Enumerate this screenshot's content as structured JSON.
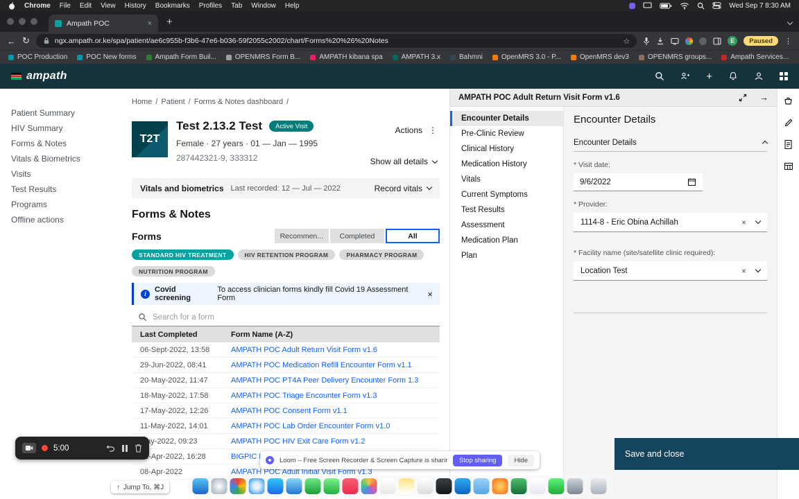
{
  "colors": {
    "header_bg": "#14333d",
    "accent_teal": "#007d79",
    "link_blue": "#0f62fe",
    "notice_bg": "#edf5ff",
    "save_bg": "#15455c",
    "loom_purple": "#625df5"
  },
  "glyphs": {
    "back": "←",
    "reload": "↻",
    "kebab": "⋮",
    "star": "☆",
    "plus": "+",
    "close": "×",
    "arrow_right": "→",
    "slash": "/",
    "info": "i",
    "up_arrow": "↑"
  },
  "menubar": {
    "items": [
      "Chrome",
      "File",
      "Edit",
      "View",
      "History",
      "Bookmarks",
      "Profiles",
      "Tab",
      "Window",
      "Help"
    ],
    "clock": "Wed Sep 7 8:30 AM"
  },
  "browser": {
    "tab_title": "Ampath POC",
    "url": "ngx.ampath.or.ke/spa/patient/ae6c955b-f3b6-47e6-b036-59f2055c2002/chart/Forms%20%26%20Notes",
    "profile_initial": "E",
    "paused_badge": "Paused",
    "bookmarks": [
      {
        "label": "POC Production",
        "color": "#0097a7"
      },
      {
        "label": "POC New forms",
        "color": "#0097a7"
      },
      {
        "label": "Ampath Form Buil...",
        "color": "#2e7d32"
      },
      {
        "label": "OPENMRS Form B...",
        "color": "#9e9e9e"
      },
      {
        "label": "AMPATH kibana spa",
        "color": "#e91e63"
      },
      {
        "label": "AMPATH 3.x",
        "color": "#00695c"
      },
      {
        "label": "Bahmni",
        "color": "#37474f"
      },
      {
        "label": "OpenMRS 3.0 - P...",
        "color": "#f57c00"
      },
      {
        "label": "OpenMRS dev3",
        "color": "#f57c00"
      },
      {
        "label": "OPENMRS groups...",
        "color": "#8d6e63"
      },
      {
        "label": "Ampath Services...",
        "color": "#c62828"
      }
    ]
  },
  "app_header": {
    "logo": "ampath"
  },
  "sidebar": {
    "items": [
      "Patient Summary",
      "HIV Summary",
      "Forms & Notes",
      "Vitals & Biometrics",
      "Visits",
      "Test Results",
      "Programs",
      "Offline actions"
    ]
  },
  "breadcrumb": [
    "Home",
    "Patient",
    "Forms & Notes dashboard"
  ],
  "patient": {
    "avatar": "T2T",
    "name": "Test 2.13.2 Test",
    "visit_tag": "Active Visit",
    "demographics": "Female · 27 years · 01 — Jan — 1995",
    "ids": "287442321-9, 333312",
    "actions": "Actions",
    "show_details": "Show all details"
  },
  "vitals_bar": {
    "title": "Vitals and biometrics",
    "last_recorded": "Last recorded: 12 — Jul — 2022",
    "record_vitals": "Record vitals"
  },
  "forms_section": {
    "page_title": "Forms & Notes",
    "widget_title": "Forms",
    "tabs": [
      "Recommen...",
      "Completed",
      "All"
    ],
    "tags": [
      "STANDARD HIV TREATMENT",
      "HIV RETENTION PROGRAM",
      "PHARMACY PROGRAM",
      "NUTRITION PROGRAM"
    ],
    "notice": {
      "title": "Covid screening",
      "message": "To access clinician forms kindly fill Covid 19 Assessment Form"
    },
    "search_placeholder": "Search for a form",
    "table": {
      "col_date": "Last Completed",
      "col_name": "Form Name (A-Z)",
      "rows": [
        {
          "date": "06-Sept-2022, 13:58",
          "name": "AMPATH POC Adult Return Visit Form v1.6"
        },
        {
          "date": "29-Jun-2022, 08:41",
          "name": "AMPATH POC Medication Refill Encounter Form v1.1"
        },
        {
          "date": "20-May-2022, 11:47",
          "name": "AMPATH POC PT4A Peer Delivery Encounter Form 1.3"
        },
        {
          "date": "18-May-2022, 17:58",
          "name": "AMPATH POC Triage Encounter Form v1.3"
        },
        {
          "date": "17-May-2022, 12:26",
          "name": "AMPATH POC Consent Form v1.1"
        },
        {
          "date": "11-May-2022, 14:01",
          "name": "AMPATH POC Lab Order Encounter Form v1.0"
        },
        {
          "date": "May-2022, 09:23",
          "name": "AMPATH POC HIV Exit Care Form v1.2"
        },
        {
          "date": "22-Apr-2022, 16:28",
          "name": "BIGPIC F"
        },
        {
          "date": "08-Apr-2022",
          "name": "AMPATH POC Adult Initial Visit Form v1.3"
        }
      ]
    }
  },
  "workspace": {
    "title": "AMPATH POC Adult Return Visit Form v1.6",
    "nav": [
      "Encounter Details",
      "Pre-Clinic Review",
      "Clinical History",
      "Medication History",
      "Vitals",
      "Current Symptoms",
      "Test Results",
      "Assessment",
      "Medication Plan",
      "Plan"
    ],
    "section_title": "Encounter Details",
    "accordion_title": "Encounter Details",
    "fields": {
      "visit_date_label": "* Visit date:",
      "visit_date_value": "9/6/2022",
      "provider_label": "* Provider:",
      "provider_value": "1114-8 - Eric Obina Achillah",
      "facility_label": "* Facility name (site/satellite clinic required):",
      "facility_value": "Location Test"
    },
    "save_button": "Save and close"
  },
  "recorder": {
    "time": "5:00"
  },
  "loom_banner": {
    "message": "Loom – Free Screen Recorder & Screen Capture is sharing your screen.",
    "stop": "Stop sharing",
    "hide": "Hide"
  },
  "jump_to": "Jump To, ⌘J",
  "dock": {
    "apps": [
      {
        "name": "finder",
        "bg": "linear-gradient(180deg,#59c3f3,#1667c9)"
      },
      {
        "name": "launchpad",
        "bg": "radial-gradient(circle,#ffffff,#9aa7b5)"
      },
      {
        "name": "chrome",
        "bg": "conic-gradient(#ea4335,#fbbc05,#34a853,#4285f4,#ea4335)"
      },
      {
        "name": "safari",
        "bg": "radial-gradient(circle,#e8f4fd 25%,#1b88e5)"
      },
      {
        "name": "app-store",
        "bg": "linear-gradient(180deg,#2fc8fa,#1a6ae8)"
      },
      {
        "name": "mail",
        "bg": "linear-gradient(180deg,#8bd5f7,#1f78d1)"
      },
      {
        "name": "facetime",
        "bg": "linear-gradient(180deg,#6ee787,#18a034)"
      },
      {
        "name": "messages",
        "bg": "linear-gradient(180deg,#7ef08c,#1fb141)"
      },
      {
        "name": "music",
        "bg": "linear-gradient(180deg,#fb5c74,#e62e4d)"
      },
      {
        "name": "photos",
        "bg": "conic-gradient(#f6c344,#ec6b56,#b460d6,#4a90e2,#50c878,#f6c344)"
      },
      {
        "name": "calendar",
        "bg": "linear-gradient(180deg,#ffffff,#e8e8e8)"
      },
      {
        "name": "notes",
        "bg": "linear-gradient(180deg,#ffe484,#ffffff)"
      },
      {
        "name": "reminders",
        "bg": "linear-gradient(180deg,#ffffff,#dcdcdc)"
      },
      {
        "name": "terminal",
        "bg": "linear-gradient(180deg,#3a3f44,#14171a)"
      },
      {
        "name": "vscode",
        "bg": "linear-gradient(180deg,#31a8f0,#0b67c2)"
      },
      {
        "name": "folder",
        "bg": "linear-gradient(180deg,#9ed0f5,#53a6e8)"
      },
      {
        "name": "firefox",
        "bg": "radial-gradient(circle,#ffd567,#ff6611)"
      },
      {
        "name": "excel",
        "bg": "linear-gradient(180deg,#4dbf6c,#156f39)"
      },
      {
        "name": "slack",
        "bg": "linear-gradient(180deg,#ffffff,#e9e4ef)"
      },
      {
        "name": "whatsapp",
        "bg": "linear-gradient(180deg,#5ef27c,#1fae38)"
      },
      {
        "name": "settings",
        "bg": "linear-gradient(180deg,#cfd4da,#7d8692)"
      },
      {
        "name": "trash",
        "bg": "linear-gradient(180deg,#e8ebee,#aab2bc)"
      }
    ]
  }
}
